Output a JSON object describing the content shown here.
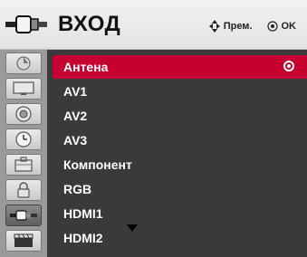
{
  "header": {
    "title": "ВХОД",
    "move_hint": "Прем.",
    "ok_hint": "OK"
  },
  "sidebar": {
    "items": [
      {
        "icon": "picture-icon",
        "active": false
      },
      {
        "icon": "screen-icon",
        "active": false
      },
      {
        "icon": "audio-icon",
        "active": false
      },
      {
        "icon": "time-icon",
        "active": false
      },
      {
        "icon": "options-icon",
        "active": false
      },
      {
        "icon": "lock-icon",
        "active": false
      },
      {
        "icon": "input-icon",
        "active": true
      },
      {
        "icon": "usb-icon",
        "active": false
      }
    ]
  },
  "list": {
    "items": [
      {
        "label": "Антена",
        "selected": true
      },
      {
        "label": "AV1",
        "selected": false
      },
      {
        "label": "AV2",
        "selected": false
      },
      {
        "label": "AV3",
        "selected": false
      },
      {
        "label": "Компонент",
        "selected": false
      },
      {
        "label": "RGB",
        "selected": false
      },
      {
        "label": "HDMI1",
        "selected": false
      },
      {
        "label": "HDMI2",
        "selected": false
      }
    ]
  },
  "colors": {
    "selected_row": "#c6002f",
    "list_background": "#3a3a3a",
    "sidebar_background": "#9a9a9a",
    "header_background": "#e8e8e8"
  }
}
